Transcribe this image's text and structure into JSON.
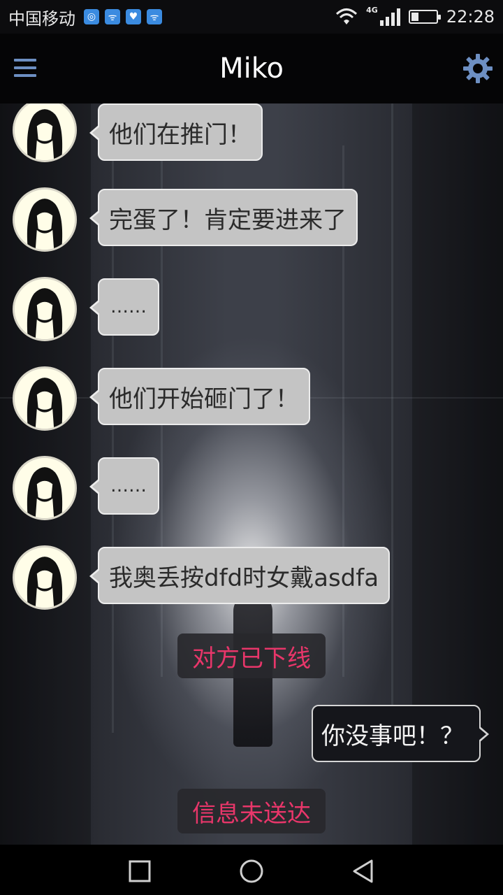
{
  "status_bar": {
    "carrier": "中国移动",
    "network": "4G",
    "time": "22:28",
    "battery_level": 0.3,
    "notification_icons": [
      "app-icon",
      "signal-app-icon",
      "heart-app-icon",
      "signal-app-icon"
    ]
  },
  "app_bar": {
    "title": "Miko",
    "menu_icon": "hamburger-icon",
    "settings_icon": "gear-icon"
  },
  "messages": [
    {
      "from": "Miko",
      "text": "他们在推门！"
    },
    {
      "from": "Miko",
      "text": "完蛋了！肯定要进来了"
    },
    {
      "from": "Miko",
      "text": "……"
    },
    {
      "from": "Miko",
      "text": "他们开始砸门了！"
    },
    {
      "from": "Miko",
      "text": "……"
    },
    {
      "from": "Miko",
      "text": "我奥丢按dfd时女戴asdfa"
    }
  ],
  "system_notices": {
    "offline": "对方已下线",
    "undelivered": "信息未送达"
  },
  "outgoing": {
    "text": "你没事吧！？"
  },
  "nav_bar": {
    "recent_icon": "square-icon",
    "home_icon": "circle-icon",
    "back_icon": "triangle-back-icon"
  },
  "colors": {
    "accent": "#6d8fc2",
    "notice_text": "#e8366a",
    "incoming_bubble": "#c4c4c4",
    "outgoing_bubble": "#15161b"
  }
}
